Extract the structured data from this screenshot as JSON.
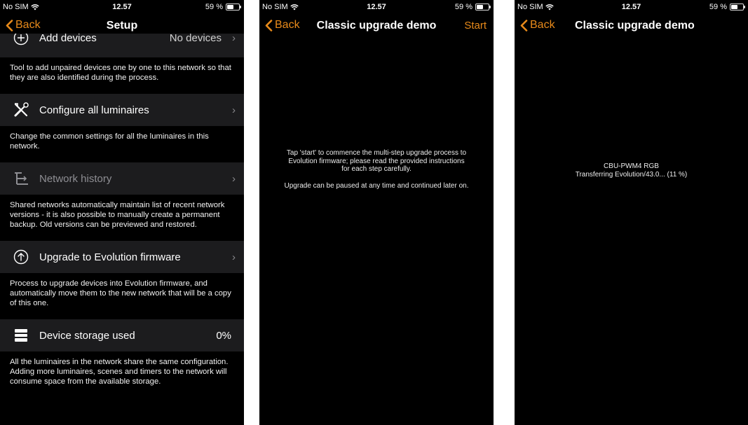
{
  "status": {
    "carrier": "No SIM",
    "time": "12.57",
    "battery": "59 %",
    "battery_level": 0.59
  },
  "screen1": {
    "back_label": "Back",
    "title": "Setup",
    "rows": [
      {
        "icon": "plus-circle-icon",
        "label": "Add devices",
        "value": "No devices",
        "description": "Tool to add unpaired devices one by one to this network so that they are also identified during the process."
      },
      {
        "icon": "tools-icon",
        "label": "Configure all luminaires",
        "value": "",
        "description": "Change the common settings for all the luminaires in this network."
      },
      {
        "icon": "network-history-icon",
        "label": "Network history",
        "value": "",
        "description": "Shared networks automatically maintain list of recent network versions - it is also possible to manually create a permanent backup. Old versions can be previewed and restored."
      },
      {
        "icon": "arrow-up-circle-icon",
        "label": "Upgrade to Evolution firmware",
        "value": "",
        "description": "Process to upgrade devices into Evolution firmware, and automatically move them to the new network that will be a copy of this one."
      },
      {
        "icon": "storage-icon",
        "label": "Device storage used",
        "value": "0%",
        "description": "All the luminaires in the network share the same configuration. Adding more luminaires, scenes and timers to the network will consume space from the available storage."
      }
    ]
  },
  "screen2": {
    "back_label": "Back",
    "title": "Classic upgrade demo",
    "action_label": "Start",
    "message_lines": [
      "Tap 'start' to commence the multi-step upgrade process to",
      "Evolution firmware; please read the provided instructions",
      "for each step carefully."
    ],
    "message_note": "Upgrade can be paused at any time and continued later on."
  },
  "screen3": {
    "back_label": "Back",
    "title": "Classic upgrade demo",
    "device": "CBU-PWM4 RGB",
    "progress_text": "Transferring Evolution/43.0... (11 %)",
    "progress": 0.11
  }
}
